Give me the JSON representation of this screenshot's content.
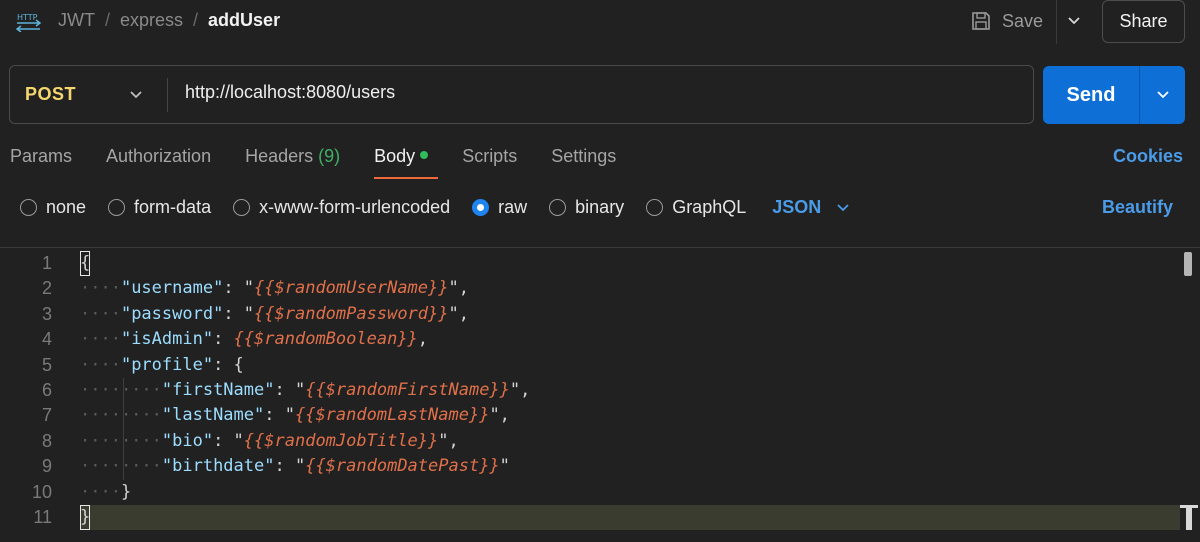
{
  "header": {
    "icon": "http-icon",
    "icon_text": "HTTP",
    "breadcrumbs": [
      "JWT",
      "express"
    ],
    "separator": "/",
    "current": "addUser",
    "save_label": "Save",
    "share_label": "Share"
  },
  "request": {
    "method": "POST",
    "url": "http://localhost:8080/users",
    "send_label": "Send"
  },
  "tabs": [
    {
      "label": "Params"
    },
    {
      "label": "Authorization"
    },
    {
      "label": "Headers",
      "count": "(9)"
    },
    {
      "label": "Body",
      "active": true
    },
    {
      "label": "Scripts"
    },
    {
      "label": "Settings"
    }
  ],
  "cookies_label": "Cookies",
  "body_types": [
    {
      "label": "none",
      "checked": false
    },
    {
      "label": "form-data",
      "checked": false
    },
    {
      "label": "x-www-form-urlencoded",
      "checked": false
    },
    {
      "label": "raw",
      "checked": true
    },
    {
      "label": "binary",
      "checked": false
    },
    {
      "label": "GraphQL",
      "checked": false
    }
  ],
  "language": "JSON",
  "beautify_label": "Beautify",
  "editor": {
    "line_numbers": [
      "1",
      "2",
      "3",
      "4",
      "5",
      "6",
      "7",
      "8",
      "9",
      "10",
      "11"
    ],
    "lines": [
      [
        {
          "t": "p",
          "v": "{"
        }
      ],
      [
        {
          "t": "k",
          "v": "\"username\""
        },
        {
          "t": "p",
          "v": ": \""
        },
        {
          "t": "v",
          "v": "{{$randomUserName}}"
        },
        {
          "t": "p",
          "v": "\","
        }
      ],
      [
        {
          "t": "k",
          "v": "\"password\""
        },
        {
          "t": "p",
          "v": ": \""
        },
        {
          "t": "v",
          "v": "{{$randomPassword}}"
        },
        {
          "t": "p",
          "v": "\","
        }
      ],
      [
        {
          "t": "k",
          "v": "\"isAdmin\""
        },
        {
          "t": "p",
          "v": ": "
        },
        {
          "t": "v",
          "v": "{{$randomBoolean}}"
        },
        {
          "t": "p",
          "v": ","
        }
      ],
      [
        {
          "t": "k",
          "v": "\"profile\""
        },
        {
          "t": "p",
          "v": ": {"
        }
      ],
      [
        {
          "t": "k",
          "v": "\"firstName\""
        },
        {
          "t": "p",
          "v": ": \""
        },
        {
          "t": "v",
          "v": "{{$randomFirstName}}"
        },
        {
          "t": "p",
          "v": "\","
        }
      ],
      [
        {
          "t": "k",
          "v": "\"lastName\""
        },
        {
          "t": "p",
          "v": ": \""
        },
        {
          "t": "v",
          "v": "{{$randomLastName}}"
        },
        {
          "t": "p",
          "v": "\","
        }
      ],
      [
        {
          "t": "k",
          "v": "\"bio\""
        },
        {
          "t": "p",
          "v": ": \""
        },
        {
          "t": "v",
          "v": "{{$randomJobTitle}}"
        },
        {
          "t": "p",
          "v": "\","
        }
      ],
      [
        {
          "t": "k",
          "v": "\"birthdate\""
        },
        {
          "t": "p",
          "v": ": \""
        },
        {
          "t": "v",
          "v": "{{$randomDatePast}}"
        },
        {
          "t": "p",
          "v": "\""
        }
      ],
      [
        {
          "t": "p",
          "v": "}"
        }
      ],
      [
        {
          "t": "p",
          "v": "}"
        }
      ]
    ],
    "indent_levels": [
      0,
      1,
      1,
      1,
      1,
      2,
      2,
      2,
      2,
      1,
      0
    ],
    "current_line": 11
  },
  "colors": {
    "background": "#212121",
    "accent_blue": "#0e6fd6",
    "link_blue": "#4a9be8",
    "method_yellow": "#f5d76e",
    "tab_underline": "#ee6a3a",
    "json_key": "#9cdcfe",
    "json_variable": "#e0704a"
  }
}
